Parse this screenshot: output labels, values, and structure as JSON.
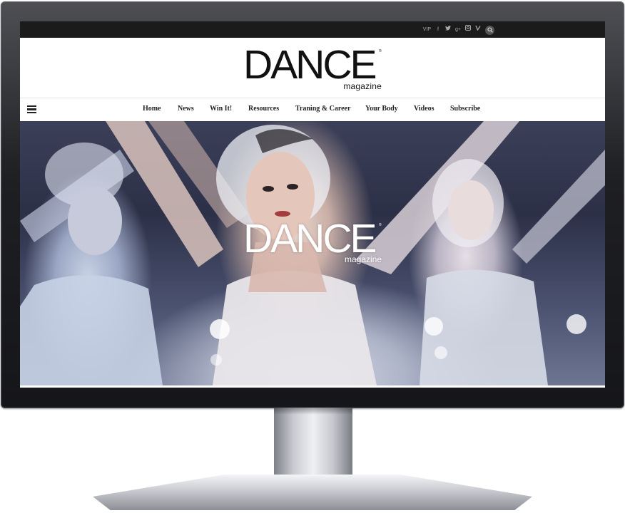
{
  "topbar": {
    "social": [
      {
        "label": "VIP",
        "icon": "vip-icon"
      },
      {
        "label": "f",
        "icon": "facebook-icon"
      },
      {
        "label": "🐦",
        "icon": "twitter-icon"
      },
      {
        "label": "g+",
        "icon": "google-plus-icon"
      },
      {
        "label": "◎",
        "icon": "instagram-icon"
      },
      {
        "label": "✓",
        "icon": "vine-icon"
      },
      {
        "label": "⌕",
        "icon": "search-icon"
      }
    ]
  },
  "header": {
    "logo_word": "DANCE",
    "logo_sub": "magazine",
    "logo_tm": "®"
  },
  "nav": {
    "menu_icon": "hamburger-menu-icon",
    "items": [
      "Home",
      "News",
      "Win It!",
      "Resources",
      "Traning & Career",
      "Your Body",
      "Videos",
      "Subscribe"
    ]
  },
  "hero": {
    "logo_word": "DANCE",
    "logo_sub": "magazine",
    "logo_tm": "®"
  },
  "colors": {
    "topbar": "#1b1b1b",
    "monitor_bezel": "#1e1f23",
    "stand": "#c9cbd1"
  }
}
